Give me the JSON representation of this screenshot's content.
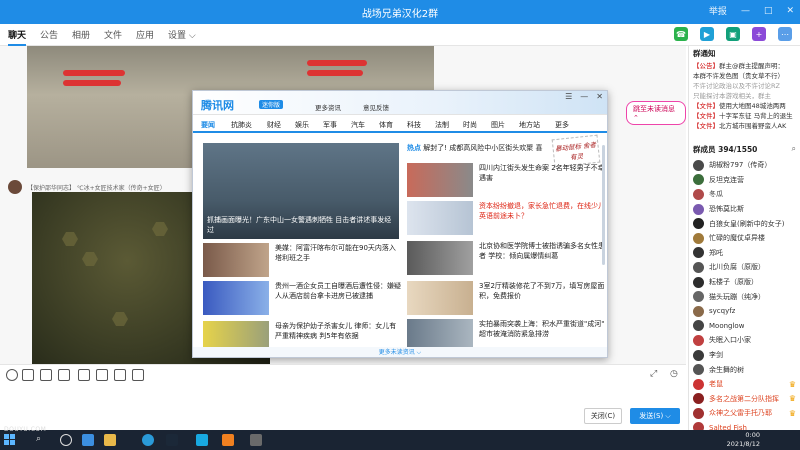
{
  "window": {
    "title": "战场兄弟汉化2群",
    "controls": [
      "举报",
      "—",
      "□",
      "✕"
    ]
  },
  "tabs": [
    {
      "label": "聊天",
      "active": true
    },
    {
      "label": "公告"
    },
    {
      "label": "相册"
    },
    {
      "label": "文件"
    },
    {
      "label": "应用"
    },
    {
      "label": "设置 ⌵"
    }
  ],
  "chat": {
    "sender": "【保护邵华同志】 ℃冰+女匠技术家（传奇+女匠）",
    "unread_pill": "跳至未读消息 ⌃"
  },
  "popup": {
    "logo": "腾讯网",
    "badge": "迷你版",
    "links": [
      "更多资讯",
      "意见反馈"
    ],
    "controls": [
      "☰",
      "—",
      "✕"
    ],
    "nav": [
      "要闻",
      "抗肺炎",
      "财经",
      "娱乐",
      "军事",
      "汽车",
      "体育",
      "科技",
      "法制",
      "时尚",
      "图片",
      "地方站",
      "更多"
    ],
    "flash_prefix": "热点",
    "flash": "解封了! 成都高风险中小区街头欢聚 喜",
    "seal": "暴动鼠标 舍者有灵",
    "main_caption": "抓捕画面曝光！广东中山一女警遇刺牺牲 目击者讲述事发经过",
    "left_items": [
      {
        "text": "美媒：阿富汗喀布尔可能在90天内落入塔利班之手"
      },
      {
        "text": "贵州一酒企女员工自曝酒后遭性侵：嫌疑人从酒店前台拿卡进房已被逮捕"
      },
      {
        "text": "母亲为保护幼子杀害女儿 律师：女儿有严重精神疾病 判5年有依据"
      }
    ],
    "right_items": [
      {
        "text": "四川内江街头发生命案 2名年轻男子不幸遇害",
        "hl": false
      },
      {
        "text": "资本纷纷撤退，家长急忙退费，在线少儿英语前途未卜？",
        "hl": true
      },
      {
        "text": "北京协和医学院博士被指诱骗多名女性患者 学校：倾向属爆情纠葛",
        "hl": false
      },
      {
        "text": "3室2厅精装修花了不到7万，填写房屋面积，免费报价",
        "hl": false
      },
      {
        "text": "实拍暴雨突袭上海：积水严重街道\"成河\" 超市被淹消防紧急排涝",
        "hl": false
      }
    ],
    "more": "更多未读资讯 ⌵"
  },
  "sidebar": {
    "notice_title": "群通知",
    "notices": [
      {
        "tag": "【公告】",
        "text": "群主@群主提醒声明：",
        "muted": false
      },
      {
        "tag": "",
        "text": "本群不许发色图（贵女草不行）",
        "muted": false
      },
      {
        "tag": "",
        "text": "不许讨论政治以及不许讨论RZ",
        "muted": true
      },
      {
        "tag": "",
        "text": "只能探讨本游戏相关，群主",
        "muted": true
      },
      {
        "tag": "【文件】",
        "text": "使用大地图48城池两两",
        "muted": false
      },
      {
        "tag": "【文件】",
        "text": "十字军东征 马背上的退生",
        "muted": false
      },
      {
        "tag": "【文件】",
        "text": "北方城市围着野蛮人AK",
        "muted": false
      }
    ],
    "members_title": "群成员 394/1550",
    "search_icon_label": "⌕",
    "members": [
      {
        "name": "胡椒粉797（传奇）",
        "color": "#333",
        "avatar": "#4a4a4a",
        "crown": false
      },
      {
        "name": "反坦克连营",
        "color": "#333",
        "avatar": "#3c6e3c",
        "crown": false
      },
      {
        "name": "冬瓜",
        "color": "#333",
        "avatar": "#b04a4a",
        "crown": false
      },
      {
        "name": "恐怖莫比斯",
        "color": "#333",
        "avatar": "#7a5ab0",
        "crown": false
      },
      {
        "name": "白狼女皇(刷新中的女子)",
        "color": "#333",
        "avatar": "#222",
        "crown": false
      },
      {
        "name": "忙碌的魔仗卓异楼",
        "color": "#333",
        "avatar": "#a07a3a",
        "crown": false
      },
      {
        "name": "郑吒",
        "color": "#333",
        "avatar": "#333",
        "crown": false
      },
      {
        "name": "北川负腐（原版）",
        "color": "#333",
        "avatar": "#555",
        "crown": false
      },
      {
        "name": "耘楼子（原版）",
        "color": "#333",
        "avatar": "#2d2d2d",
        "crown": false
      },
      {
        "name": "猫头玩蹦（纯净）",
        "color": "#333",
        "avatar": "#666",
        "crown": false
      },
      {
        "name": "sycqyfz",
        "color": "#333",
        "avatar": "#8a6a4a",
        "crown": false
      },
      {
        "name": "Moonglow",
        "color": "#333",
        "avatar": "#444",
        "crown": false
      },
      {
        "name": "失眠入口小家",
        "color": "#333",
        "avatar": "#c04040",
        "crown": false
      },
      {
        "name": "李剑",
        "color": "#333",
        "avatar": "#3a3a3a",
        "crown": false
      },
      {
        "name": "余生舞的树",
        "color": "#333",
        "avatar": "#555",
        "crown": false
      },
      {
        "name": "老鼠",
        "color": "#d42",
        "avatar": "#c33",
        "crown": true
      },
      {
        "name": "多名之战第二分队指挥",
        "color": "#d42",
        "avatar": "#8a2020",
        "crown": true
      },
      {
        "name": "众神之父雷手托乃耶",
        "color": "#d42",
        "avatar": "#a03030",
        "crown": true
      },
      {
        "name": "Salted Fish",
        "color": "#d42",
        "avatar": "#b03a3a",
        "crown": false
      },
      {
        "name": "天天数数",
        "color": "#d42",
        "avatar": "#993333",
        "crown": false
      }
    ]
  },
  "buttons": {
    "close": "关闭(C)",
    "send": "发送(S) ⌵"
  },
  "taskbar": {
    "time": "0:00",
    "date": "2021/8/12",
    "watermark": "DOUYU.COM"
  },
  "colors": {
    "accent": "#1f8ce6",
    "taskbar": "#1a2433",
    "highlight_red": "#d21"
  }
}
